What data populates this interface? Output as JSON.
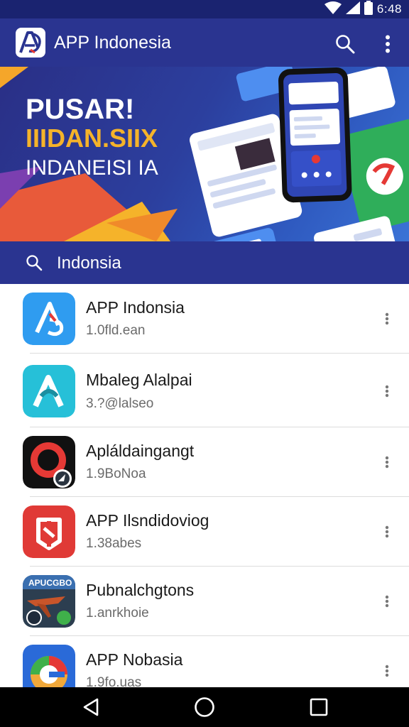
{
  "status_bar": {
    "time": "6:48",
    "icons": [
      "wifi-icon",
      "signal-icon",
      "battery-icon"
    ]
  },
  "app_bar": {
    "title": "APP Indonesia",
    "logo_icon": "ai-logo-icon",
    "actions": [
      "search-icon",
      "more-vert-icon"
    ]
  },
  "banner": {
    "line1": "PUSAR!",
    "line2": "IIIDAN.SIIX",
    "line3": "INDANEISI IA"
  },
  "search": {
    "text": "Indonsia",
    "icon": "search-icon"
  },
  "apps": [
    {
      "title": "APP Indonsia",
      "subtitle": "1.0fld.ean",
      "icon": "blue-arrow-icon"
    },
    {
      "title": "Mbaleg Alalpai",
      "subtitle": "3.?@lalseo",
      "icon": "teal-a-icon"
    },
    {
      "title": "Apláldaingangt",
      "subtitle": "1.9BoNoa",
      "icon": "red-ring-icon"
    },
    {
      "title": "APP Ilsndidoviog",
      "subtitle": "1.38abes",
      "icon": "red-shield-icon"
    },
    {
      "title": "Pubnalchgtons",
      "subtitle": "1.anrkhoie",
      "icon": "airplane-icon"
    },
    {
      "title": "APP Nobasia",
      "subtitle": "1.9fo.uas",
      "icon": "g-logo-icon"
    }
  ],
  "colors": {
    "primary": "#2a3490",
    "status": "#1a2370",
    "accent": "#f5b32a"
  },
  "nav_bar": {
    "buttons": [
      "back-icon",
      "home-icon",
      "recents-icon"
    ]
  }
}
